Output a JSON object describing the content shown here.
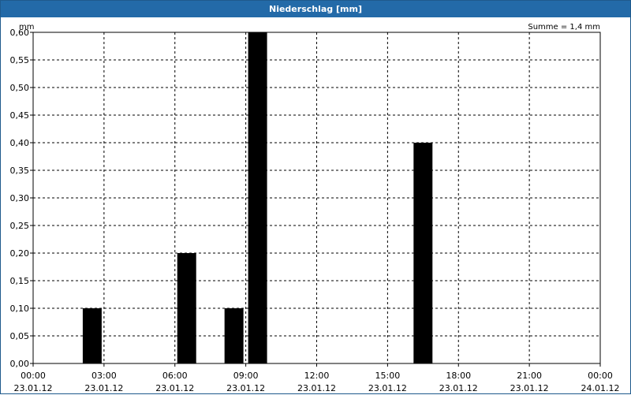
{
  "window": {
    "title": "Niederschlag [mm]"
  },
  "chart_data": {
    "type": "bar",
    "title": "Niederschlag [mm]",
    "ylabel": "mm",
    "summary": "Summe = 1,4 mm",
    "ylim": [
      0,
      0.6
    ],
    "yticks": [
      "0,00",
      "0,05",
      "0,10",
      "0,15",
      "0,20",
      "0,25",
      "0,30",
      "0,35",
      "0,40",
      "0,45",
      "0,50",
      "0,55",
      "0,60"
    ],
    "xlim_hours": [
      0,
      24
    ],
    "xticks": [
      {
        "time": "00:00",
        "date": "23.01.12"
      },
      {
        "time": "03:00",
        "date": "23.01.12"
      },
      {
        "time": "06:00",
        "date": "23.01.12"
      },
      {
        "time": "09:00",
        "date": "23.01.12"
      },
      {
        "time": "12:00",
        "date": "23.01.12"
      },
      {
        "time": "15:00",
        "date": "23.01.12"
      },
      {
        "time": "18:00",
        "date": "23.01.12"
      },
      {
        "time": "21:00",
        "date": "23.01.12"
      },
      {
        "time": "00:00",
        "date": "24.01.12"
      }
    ],
    "bars": [
      {
        "hour": 2.5,
        "value": 0.1
      },
      {
        "hour": 6.5,
        "value": 0.2
      },
      {
        "hour": 8.5,
        "value": 0.1
      },
      {
        "hour": 9.5,
        "value": 0.6
      },
      {
        "hour": 16.5,
        "value": 0.4
      }
    ],
    "bar_color": "#000000",
    "grid": true
  }
}
